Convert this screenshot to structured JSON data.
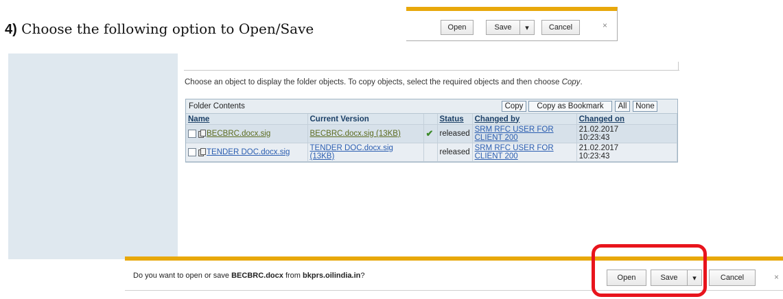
{
  "step": {
    "number": "4)",
    "text": "Choose the following option to Open/Save"
  },
  "mini_dialog": {
    "open": "Open",
    "save": "Save",
    "dropdown": "▾",
    "cancel": "Cancel",
    "close": "×"
  },
  "instruction": {
    "text": "Choose an object to display the folder objects. To copy objects, select the required objects and then choose ",
    "emph": "Copy",
    "end": "."
  },
  "folder": {
    "title": "Folder Contents",
    "buttons": {
      "copy": "Copy",
      "copy_bookmark": "Copy as Bookmark",
      "all": "All",
      "none": "None"
    },
    "columns": {
      "name": "Name",
      "version": "Current Version",
      "status": "Status",
      "changed_by": "Changed by",
      "changed_on": "Changed on"
    },
    "rows": [
      {
        "name": "BECBRC.docx.sig",
        "version": "BECBRC.docx.sig (13KB)",
        "status_icon": "check-icon",
        "status": "released",
        "changed_by_1": "SRM RFC USER FOR",
        "changed_by_2": "CLIENT 200",
        "date": "21.02.2017",
        "time": "10:23:43"
      },
      {
        "name": "TENDER DOC.docx.sig",
        "version_1": "TENDER DOC.docx.sig",
        "version_2": "(13KB)",
        "status": "released",
        "changed_by_1": "SRM RFC USER FOR",
        "changed_by_2": "CLIENT 200",
        "date": "21.02.2017",
        "time": "10:23:43"
      }
    ]
  },
  "notification": {
    "prefix": "Do you want to open or save ",
    "file": "BECBRC.docx",
    "middle": " from ",
    "site": "bkprs.oilindia.in",
    "suffix": "?",
    "open": "Open",
    "save": "Save",
    "dropdown": "▾",
    "cancel": "Cancel",
    "close": "×"
  },
  "colors": {
    "notification_accent": "#e8a80b",
    "highlight": "#e8141c"
  }
}
